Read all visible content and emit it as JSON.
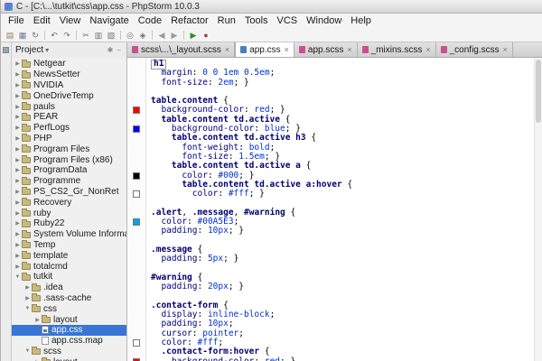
{
  "window": {
    "title": "C - [C:\\...\\tutkit\\css\\app.css - PhpStorm 10.0.3"
  },
  "menu": [
    "File",
    "Edit",
    "View",
    "Navigate",
    "Code",
    "Refactor",
    "Run",
    "Tools",
    "VCS",
    "Window",
    "Help"
  ],
  "toolbar": [
    {
      "name": "open",
      "glyph": "▤",
      "color": "#8d7f57"
    },
    {
      "name": "save-all",
      "glyph": "▦",
      "color": "#6b7b99"
    },
    {
      "name": "synchronize",
      "glyph": "↻",
      "color": "#707070"
    },
    {
      "sep": true
    },
    {
      "name": "undo",
      "glyph": "↶",
      "color": "#707070"
    },
    {
      "name": "redo",
      "glyph": "↷",
      "color": "#707070"
    },
    {
      "sep": true
    },
    {
      "name": "cut",
      "glyph": "✂",
      "color": "#707070"
    },
    {
      "name": "copy",
      "glyph": "▥",
      "color": "#707070"
    },
    {
      "name": "paste",
      "glyph": "▧",
      "color": "#707070"
    },
    {
      "sep": true
    },
    {
      "name": "find",
      "glyph": "◎",
      "color": "#707070"
    },
    {
      "name": "replace",
      "glyph": "◈",
      "color": "#707070"
    },
    {
      "sep": true
    },
    {
      "name": "back",
      "glyph": "◀",
      "color": "#9a9a9a"
    },
    {
      "name": "forward",
      "glyph": "▶",
      "color": "#9a9a9a"
    },
    {
      "sep": true
    },
    {
      "name": "run",
      "glyph": "▶",
      "color": "#2e8b2e"
    },
    {
      "name": "debug",
      "glyph": "●",
      "color": "#9c4a4a"
    }
  ],
  "ui": {
    "expanded": "▼",
    "collapsed": "▶",
    "close": "×",
    "caret": "▾",
    "header_icons": [
      {
        "name": "settings",
        "glyph": "✱"
      },
      {
        "name": "hide-panel",
        "glyph": "−"
      }
    ]
  },
  "project": {
    "header": "Project",
    "tree": [
      {
        "label": "Netgear",
        "depth": 1,
        "arrow": "c",
        "icon": "folder"
      },
      {
        "label": "NewsSetter",
        "depth": 1,
        "arrow": "c",
        "icon": "folder"
      },
      {
        "label": "NVIDIA",
        "depth": 1,
        "arrow": "c",
        "icon": "folder"
      },
      {
        "label": "OneDriveTemp",
        "depth": 1,
        "arrow": "c",
        "icon": "folder"
      },
      {
        "label": "pauls",
        "depth": 1,
        "arrow": "c",
        "icon": "folder"
      },
      {
        "label": "PEAR",
        "depth": 1,
        "arrow": "c",
        "icon": "folder"
      },
      {
        "label": "PerfLogs",
        "depth": 1,
        "arrow": "c",
        "icon": "folder"
      },
      {
        "label": "PHP",
        "depth": 1,
        "arrow": "c",
        "icon": "folder"
      },
      {
        "label": "Program Files",
        "depth": 1,
        "arrow": "c",
        "icon": "folder"
      },
      {
        "label": "Program Files (x86)",
        "depth": 1,
        "arrow": "c",
        "icon": "folder"
      },
      {
        "label": "ProgramData",
        "depth": 1,
        "arrow": "c",
        "icon": "folder"
      },
      {
        "label": "Programme",
        "depth": 1,
        "arrow": "c",
        "icon": "folder"
      },
      {
        "label": "PS_CS2_Gr_NonRet",
        "depth": 1,
        "arrow": "c",
        "icon": "folder"
      },
      {
        "label": "Recovery",
        "depth": 1,
        "arrow": "c",
        "icon": "folder"
      },
      {
        "label": "ruby",
        "depth": 1,
        "arrow": "c",
        "icon": "folder"
      },
      {
        "label": "Ruby22",
        "depth": 1,
        "arrow": "c",
        "icon": "folder"
      },
      {
        "label": "System Volume Information",
        "depth": 1,
        "arrow": "c",
        "icon": "folder"
      },
      {
        "label": "Temp",
        "depth": 1,
        "arrow": "c",
        "icon": "folder"
      },
      {
        "label": "template",
        "depth": 1,
        "arrow": "c",
        "icon": "folder"
      },
      {
        "label": "totalcmd",
        "depth": 1,
        "arrow": "c",
        "icon": "folder"
      },
      {
        "label": "tutkit",
        "depth": 1,
        "arrow": "e",
        "icon": "folder"
      },
      {
        "label": ".idea",
        "depth": 2,
        "arrow": "c",
        "icon": "folder"
      },
      {
        "label": ".sass-cache",
        "depth": 2,
        "arrow": "c",
        "icon": "folder"
      },
      {
        "label": "css",
        "depth": 2,
        "arrow": "e",
        "icon": "folder"
      },
      {
        "label": "layout",
        "depth": 3,
        "arrow": "c",
        "icon": "folder"
      },
      {
        "label": "app.css",
        "depth": 3,
        "arrow": "",
        "icon": "css",
        "selected": true
      },
      {
        "label": "app.css.map",
        "depth": 3,
        "arrow": "",
        "icon": "file"
      },
      {
        "label": "scss",
        "depth": 2,
        "arrow": "e",
        "icon": "folder"
      },
      {
        "label": "layout",
        "depth": 3,
        "arrow": "c",
        "icon": "folder"
      }
    ]
  },
  "tabs": [
    {
      "label": "scss\\...\\_layout.scss",
      "type": "scss",
      "active": false
    },
    {
      "label": "app.css",
      "type": "css",
      "active": true
    },
    {
      "label": "app.scss",
      "type": "scss",
      "active": false
    },
    {
      "label": "_mixins.scss",
      "type": "scss",
      "active": false
    },
    {
      "label": "_config.scss",
      "type": "scss",
      "active": false
    }
  ],
  "editor": {
    "file": "app.css",
    "lines": [
      {
        "box": true,
        "tokens": [
          [
            "s",
            "h1"
          ]
        ]
      },
      {
        "tokens": [
          [
            "d",
            "  "
          ],
          [
            "p",
            "margin"
          ],
          [
            "d",
            ": "
          ],
          [
            "v",
            "0 0 1em 0.5em"
          ],
          [
            "d",
            ";"
          ]
        ]
      },
      {
        "tokens": [
          [
            "d",
            "  "
          ],
          [
            "p",
            "font-size"
          ],
          [
            "d",
            ": "
          ],
          [
            "v",
            "2em"
          ],
          [
            "d",
            "; }"
          ]
        ]
      },
      {
        "tokens": []
      },
      {
        "tokens": [
          [
            "s",
            "table.content"
          ],
          [
            "d",
            " {"
          ]
        ]
      },
      {
        "swatch": "red",
        "tokens": [
          [
            "d",
            "  "
          ],
          [
            "p",
            "background-color"
          ],
          [
            "d",
            ": "
          ],
          [
            "v",
            "red"
          ],
          [
            "d",
            "; }"
          ]
        ]
      },
      {
        "tokens": [
          [
            "d",
            "  "
          ],
          [
            "s",
            "table.content td.active"
          ],
          [
            "d",
            " {"
          ]
        ]
      },
      {
        "swatch": "blue",
        "tokens": [
          [
            "d",
            "    "
          ],
          [
            "p",
            "background-color"
          ],
          [
            "d",
            ": "
          ],
          [
            "v",
            "blue"
          ],
          [
            "d",
            "; }"
          ]
        ]
      },
      {
        "tokens": [
          [
            "d",
            "    "
          ],
          [
            "s",
            "table.content td.active h3"
          ],
          [
            "d",
            " {"
          ]
        ]
      },
      {
        "tokens": [
          [
            "d",
            "      "
          ],
          [
            "p",
            "font-weight"
          ],
          [
            "d",
            ": "
          ],
          [
            "v",
            "bold"
          ],
          [
            "d",
            ";"
          ]
        ]
      },
      {
        "tokens": [
          [
            "d",
            "      "
          ],
          [
            "p",
            "font-size"
          ],
          [
            "d",
            ": "
          ],
          [
            "v",
            "1.5em"
          ],
          [
            "d",
            "; }"
          ]
        ]
      },
      {
        "tokens": [
          [
            "d",
            "    "
          ],
          [
            "s",
            "table.content td.active a"
          ],
          [
            "d",
            " {"
          ]
        ]
      },
      {
        "swatch": "#000000",
        "tokens": [
          [
            "d",
            "      "
          ],
          [
            "p",
            "color"
          ],
          [
            "d",
            ": "
          ],
          [
            "v",
            "#000"
          ],
          [
            "d",
            "; }"
          ]
        ]
      },
      {
        "tokens": [
          [
            "d",
            "      "
          ],
          [
            "s",
            "table.content td.active a:hover"
          ],
          [
            "d",
            " {"
          ]
        ]
      },
      {
        "swatch": "#ffffff",
        "tokens": [
          [
            "d",
            "        "
          ],
          [
            "p",
            "color"
          ],
          [
            "d",
            ": "
          ],
          [
            "v",
            "#fff"
          ],
          [
            "d",
            "; }"
          ]
        ]
      },
      {
        "tokens": []
      },
      {
        "tokens": [
          [
            "s",
            ".alert"
          ],
          [
            "d",
            ", "
          ],
          [
            "s",
            ".message"
          ],
          [
            "d",
            ", "
          ],
          [
            "s",
            "#warning"
          ],
          [
            "d",
            " {"
          ]
        ]
      },
      {
        "swatch": "#00A5E3",
        "tokens": [
          [
            "d",
            "  "
          ],
          [
            "p",
            "color"
          ],
          [
            "d",
            ": "
          ],
          [
            "v",
            "#00A5E3"
          ],
          [
            "d",
            ";"
          ]
        ]
      },
      {
        "tokens": [
          [
            "d",
            "  "
          ],
          [
            "p",
            "padding"
          ],
          [
            "d",
            ": "
          ],
          [
            "v",
            "10px"
          ],
          [
            "d",
            "; }"
          ]
        ]
      },
      {
        "tokens": []
      },
      {
        "tokens": [
          [
            "s",
            ".message"
          ],
          [
            "d",
            " {"
          ]
        ]
      },
      {
        "tokens": [
          [
            "d",
            "  "
          ],
          [
            "p",
            "padding"
          ],
          [
            "d",
            ": "
          ],
          [
            "v",
            "5px"
          ],
          [
            "d",
            "; }"
          ]
        ]
      },
      {
        "tokens": []
      },
      {
        "tokens": [
          [
            "s",
            "#warning"
          ],
          [
            "d",
            " {"
          ]
        ]
      },
      {
        "tokens": [
          [
            "d",
            "  "
          ],
          [
            "p",
            "padding"
          ],
          [
            "d",
            ": "
          ],
          [
            "v",
            "20px"
          ],
          [
            "d",
            "; }"
          ]
        ]
      },
      {
        "tokens": []
      },
      {
        "tokens": [
          [
            "s",
            ".contact-form"
          ],
          [
            "d",
            " {"
          ]
        ]
      },
      {
        "tokens": [
          [
            "d",
            "  "
          ],
          [
            "p",
            "display"
          ],
          [
            "d",
            ": "
          ],
          [
            "v",
            "inline-block"
          ],
          [
            "d",
            ";"
          ]
        ]
      },
      {
        "tokens": [
          [
            "d",
            "  "
          ],
          [
            "p",
            "padding"
          ],
          [
            "d",
            ": "
          ],
          [
            "v",
            "10px"
          ],
          [
            "d",
            ";"
          ]
        ]
      },
      {
        "tokens": [
          [
            "d",
            "  "
          ],
          [
            "p",
            "cursor"
          ],
          [
            "d",
            ": "
          ],
          [
            "v",
            "pointer"
          ],
          [
            "d",
            ";"
          ]
        ]
      },
      {
        "swatch": "#ffffff",
        "tokens": [
          [
            "d",
            "  "
          ],
          [
            "p",
            "color"
          ],
          [
            "d",
            ": "
          ],
          [
            "v",
            "#fff"
          ],
          [
            "d",
            ";"
          ]
        ]
      },
      {
        "tokens": [
          [
            "d",
            "  "
          ],
          [
            "s",
            ".contact-form:hover"
          ],
          [
            "d",
            " {"
          ]
        ]
      },
      {
        "swatch": "red",
        "tokens": [
          [
            "d",
            "    "
          ],
          [
            "p",
            "background-color"
          ],
          [
            "d",
            ": "
          ],
          [
            "v",
            "red"
          ],
          [
            "d",
            "; }"
          ]
        ]
      }
    ]
  },
  "colors": {
    "selection": "#3875d6",
    "css_file": "#4a7fbf",
    "scss_file": "#c94f8e"
  }
}
